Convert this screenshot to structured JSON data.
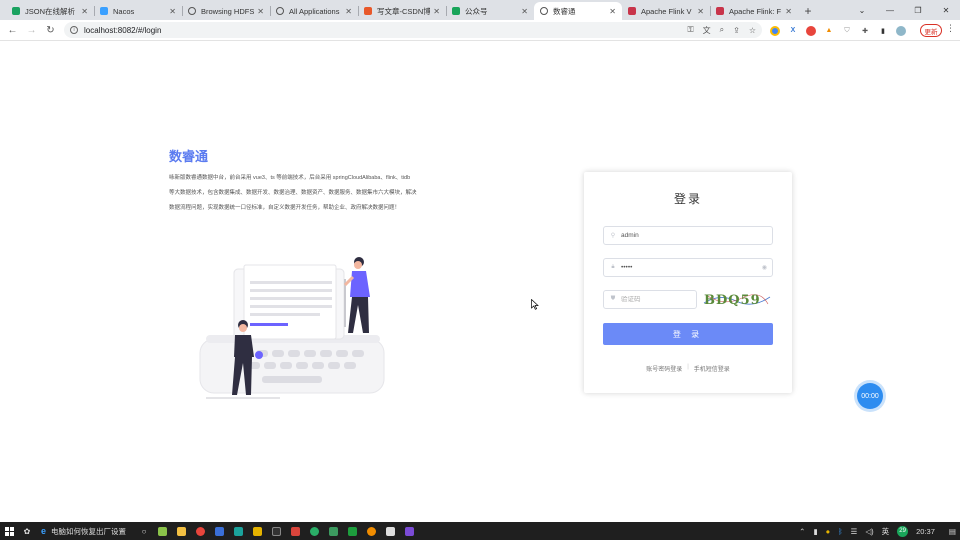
{
  "browser": {
    "tabs": [
      {
        "title": "JSON在线解析",
        "icon": "json-tab-icon",
        "color": "#1aa260"
      },
      {
        "title": "Nacos",
        "icon": "nacos-tab-icon",
        "color": "#3aa0ff"
      },
      {
        "title": "Browsing HDFS",
        "icon": "globe-icon",
        "color": "#555555"
      },
      {
        "title": "All Applications",
        "icon": "globe-icon",
        "color": "#555555"
      },
      {
        "title": "写文章-CSDN博",
        "icon": "csdn-tab-icon",
        "color": "#e8582a"
      },
      {
        "title": "公众号",
        "icon": "wechat-mp-tab-icon",
        "color": "#19a55a"
      },
      {
        "title": "数睿通",
        "icon": "globe-icon",
        "color": "#555555",
        "active": true
      },
      {
        "title": "Apache Flink V",
        "icon": "flink-tab-icon",
        "color": "#c8344a"
      },
      {
        "title": "Apache Flink: F",
        "icon": "flink-tab-icon",
        "color": "#c8344a"
      }
    ],
    "url": "localhost:8082/#/login",
    "update_label": "更新"
  },
  "page": {
    "title": "数睿通",
    "description": "咏新版数睿通数据中台，前台采用 vue3、ts 等前端技术，后台采用 springCloudAlibaba、flink、tidb 等大数据技术，包含数据集成、数据开发、数据治理、数据资产、数据服务、数据集市六大模块，解决数据流程问题，实现数据统一口径标准，自定义数据开发任务，帮助企业、政府解决数据问题！"
  },
  "login": {
    "title": "登录",
    "username_value": "admin",
    "password_value": "•••••",
    "captcha_placeholder": "验证码",
    "captcha_text": "BDQ59",
    "button_label": "登 录",
    "link_account": "账号密码登录",
    "link_phone": "手机短信登录"
  },
  "timer": "00:00",
  "taskbar": {
    "search_text": "电脑如何恢复出厂设置",
    "tray_lang": "英",
    "tray_badge": "29",
    "clock": "20:37"
  },
  "colors": {
    "accent": "#6b8af7",
    "title_blue": "#5b7bf0",
    "timer_blue": "#2d8cf0"
  }
}
